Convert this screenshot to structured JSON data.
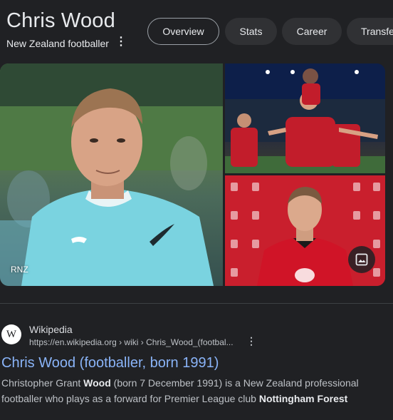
{
  "entity": {
    "title": "Chris Wood",
    "subtitle": "New Zealand footballer"
  },
  "tabs": [
    {
      "label": "Overview",
      "active": true
    },
    {
      "label": "Stats",
      "active": false
    },
    {
      "label": "Career",
      "active": false
    },
    {
      "label": "Transfe",
      "active": false
    }
  ],
  "images": {
    "main_caption": "RNZ",
    "colors": {
      "nz_shirt": "#7ad3e0",
      "forest_red": "#c91f2d"
    }
  },
  "result": {
    "site_name": "Wikipedia",
    "url": "https://en.wikipedia.org › wiki › Chris_Wood_(footbal...",
    "favicon_letter": "W",
    "title": "Chris Wood (footballer, born 1991)",
    "snippet": {
      "part1": "Christopher Grant ",
      "bold1": "Wood",
      "part2": " (born 7 December 1991) is a New Zealand professional footballer who plays as a forward for Premier League club ",
      "bold2": "Nottingham Forest"
    }
  },
  "icons": {
    "more": "more-vert-icon",
    "image_search": "image-icon"
  },
  "theme": {
    "background": "#202124",
    "link": "#8ab4f8"
  }
}
